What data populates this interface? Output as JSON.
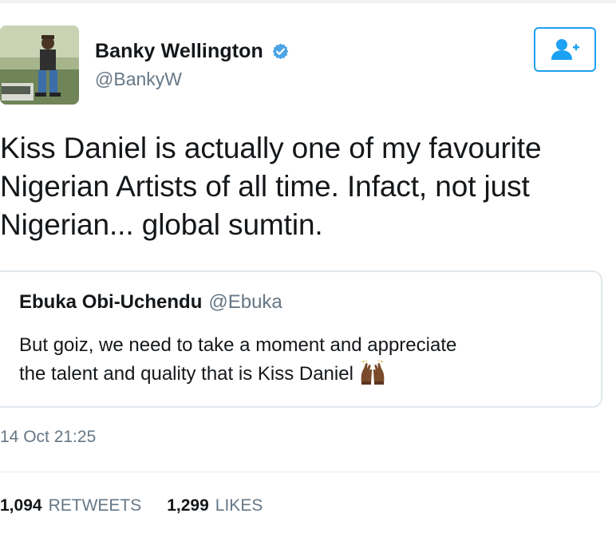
{
  "tweet": {
    "author": {
      "display_name": "Banky Wellington",
      "handle": "@BankyW",
      "verified": true,
      "avatar_icon": "profile-photo"
    },
    "follow_icon": "follow-user-icon",
    "text": "Kiss Daniel is actually one of my favourite\nNigerian Artists of all time. Infact, not just\nNigerian... global sumtin.",
    "quoted": {
      "display_name": "Ebuka Obi-Uchendu",
      "handle": "@Ebuka",
      "text": "But goiz, we need to take a moment and appreciate\nthe talent and quality that is Kiss Daniel",
      "emoji_icon": "raised-hands-icon"
    },
    "timestamp": "14 Oct 21:25",
    "stats": {
      "retweets_count": "1,094",
      "retweets_label": "RETWEETS",
      "likes_count": "1,299",
      "likes_label": "LIKES"
    }
  },
  "colors": {
    "accent": "#1da1f2",
    "text_primary": "#14171a",
    "text_secondary": "#657786",
    "border": "#e1e8ed"
  }
}
